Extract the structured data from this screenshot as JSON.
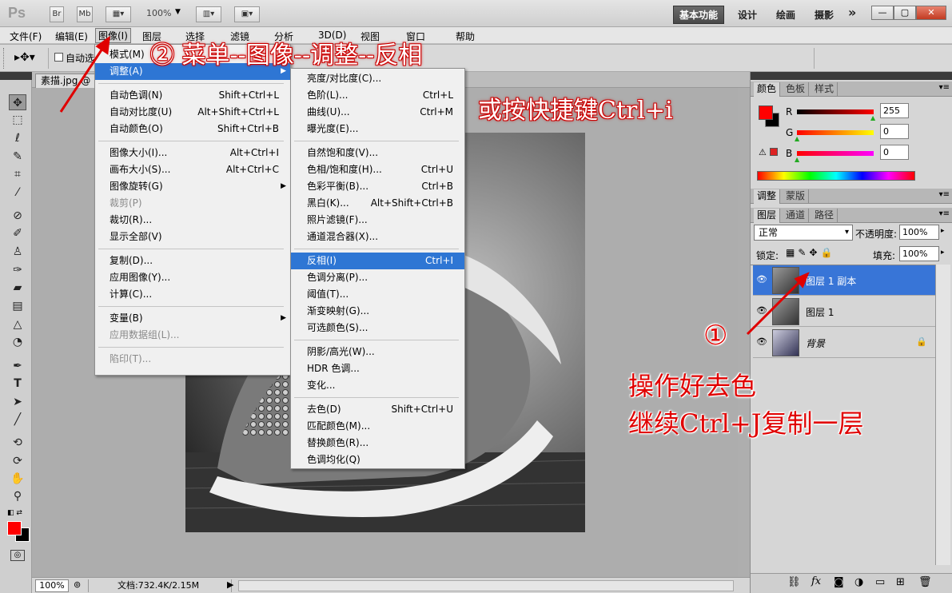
{
  "titlebar": {
    "logo": "Ps",
    "btn_br": "Br",
    "btn_mb": "Mb",
    "zoom": "100%",
    "workspaces": [
      "基本功能",
      "设计",
      "绘画",
      "摄影"
    ],
    "more": "»"
  },
  "menubar": {
    "items": [
      "文件(F)",
      "编辑(E)",
      "图像(I)",
      "图层",
      "选择",
      "滤镜",
      "分析",
      "3D(D)",
      "视图",
      "窗口",
      "帮助"
    ]
  },
  "optbar": {
    "auto_select_label": "自动选"
  },
  "document": {
    "tab_label": "素描.jpg @"
  },
  "statusbar": {
    "zoom": "100%",
    "doc_info": "文档:732.4K/2.15M"
  },
  "image_menu": {
    "items": [
      {
        "label": "模式(M)",
        "shortcut": "",
        "submenu": true,
        "state": "normal"
      },
      {
        "label": "调整(A)",
        "shortcut": "",
        "submenu": true,
        "state": "selected"
      },
      {
        "label": "自动色调(N)",
        "shortcut": "Shift+Ctrl+L",
        "submenu": false,
        "state": "normal"
      },
      {
        "label": "自动对比度(U)",
        "shortcut": "Alt+Shift+Ctrl+L",
        "submenu": false,
        "state": "normal"
      },
      {
        "label": "自动颜色(O)",
        "shortcut": "Shift+Ctrl+B",
        "submenu": false,
        "state": "normal"
      },
      {
        "label": "图像大小(I)...",
        "shortcut": "Alt+Ctrl+I",
        "submenu": false,
        "state": "normal"
      },
      {
        "label": "画布大小(S)...",
        "shortcut": "Alt+Ctrl+C",
        "submenu": false,
        "state": "normal"
      },
      {
        "label": "图像旋转(G)",
        "shortcut": "",
        "submenu": true,
        "state": "normal"
      },
      {
        "label": "裁剪(P)",
        "shortcut": "",
        "submenu": false,
        "state": "disabled"
      },
      {
        "label": "裁切(R)...",
        "shortcut": "",
        "submenu": false,
        "state": "normal"
      },
      {
        "label": "显示全部(V)",
        "shortcut": "",
        "submenu": false,
        "state": "normal"
      },
      {
        "label": "复制(D)...",
        "shortcut": "",
        "submenu": false,
        "state": "normal"
      },
      {
        "label": "应用图像(Y)...",
        "shortcut": "",
        "submenu": false,
        "state": "normal"
      },
      {
        "label": "计算(C)...",
        "shortcut": "",
        "submenu": false,
        "state": "normal"
      },
      {
        "label": "变量(B)",
        "shortcut": "",
        "submenu": true,
        "state": "normal"
      },
      {
        "label": "应用数据组(L)...",
        "shortcut": "",
        "submenu": false,
        "state": "disabled"
      },
      {
        "label": "陷印(T)...",
        "shortcut": "",
        "submenu": false,
        "state": "disabled"
      }
    ]
  },
  "adjust_menu": {
    "items": [
      {
        "label": "亮度/对比度(C)...",
        "shortcut": ""
      },
      {
        "label": "色阶(L)...",
        "shortcut": "Ctrl+L"
      },
      {
        "label": "曲线(U)...",
        "shortcut": "Ctrl+M"
      },
      {
        "label": "曝光度(E)...",
        "shortcut": ""
      },
      {
        "label": "自然饱和度(V)...",
        "shortcut": ""
      },
      {
        "label": "色相/饱和度(H)...",
        "shortcut": "Ctrl+U"
      },
      {
        "label": "色彩平衡(B)...",
        "shortcut": "Ctrl+B"
      },
      {
        "label": "黑白(K)...",
        "shortcut": "Alt+Shift+Ctrl+B"
      },
      {
        "label": "照片滤镜(F)...",
        "shortcut": ""
      },
      {
        "label": "通道混合器(X)...",
        "shortcut": ""
      },
      {
        "label": "反相(I)",
        "shortcut": "Ctrl+I"
      },
      {
        "label": "色调分离(P)...",
        "shortcut": ""
      },
      {
        "label": "阈值(T)...",
        "shortcut": ""
      },
      {
        "label": "渐变映射(G)...",
        "shortcut": ""
      },
      {
        "label": "可选颜色(S)...",
        "shortcut": ""
      },
      {
        "label": "阴影/高光(W)...",
        "shortcut": ""
      },
      {
        "label": "HDR 色调...",
        "shortcut": ""
      },
      {
        "label": "变化...",
        "shortcut": ""
      },
      {
        "label": "去色(D)",
        "shortcut": "Shift+Ctrl+U"
      },
      {
        "label": "匹配颜色(M)...",
        "shortcut": ""
      },
      {
        "label": "替换颜色(R)...",
        "shortcut": ""
      },
      {
        "label": "色调均化(Q)",
        "shortcut": ""
      }
    ]
  },
  "color_panel": {
    "tabs": [
      "颜色",
      "色板",
      "样式"
    ],
    "channels": [
      {
        "name": "R",
        "value": "255",
        "color": "#ff0000"
      },
      {
        "name": "G",
        "value": "0",
        "color": "#ffff00"
      },
      {
        "name": "B",
        "value": "0",
        "color": "#ff00ff"
      }
    ],
    "foreground": "#ff0000",
    "background": "#000000"
  },
  "adjust_panel": {
    "tabs": [
      "调整",
      "蒙版"
    ]
  },
  "layers_panel": {
    "tabs": [
      "图层",
      "通道",
      "路径"
    ],
    "blend_mode": "正常",
    "opacity_label": "不透明度:",
    "opacity": "100%",
    "lock_label": "锁定:",
    "fill_label": "填充:",
    "fill": "100%",
    "layers": [
      {
        "name": "图层 1 副本",
        "selected": true,
        "locked": false
      },
      {
        "name": "图层 1",
        "selected": false,
        "locked": false
      },
      {
        "name": "背景",
        "selected": false,
        "locked": true
      }
    ]
  },
  "annotations": {
    "step2": "② 菜单--图像--调整--反相",
    "shortcut": "或按快捷键Ctrl+i",
    "circle1": "①",
    "step1_line1": "操作好去色",
    "step1_line2": "继续Ctrl+J复制一层"
  }
}
